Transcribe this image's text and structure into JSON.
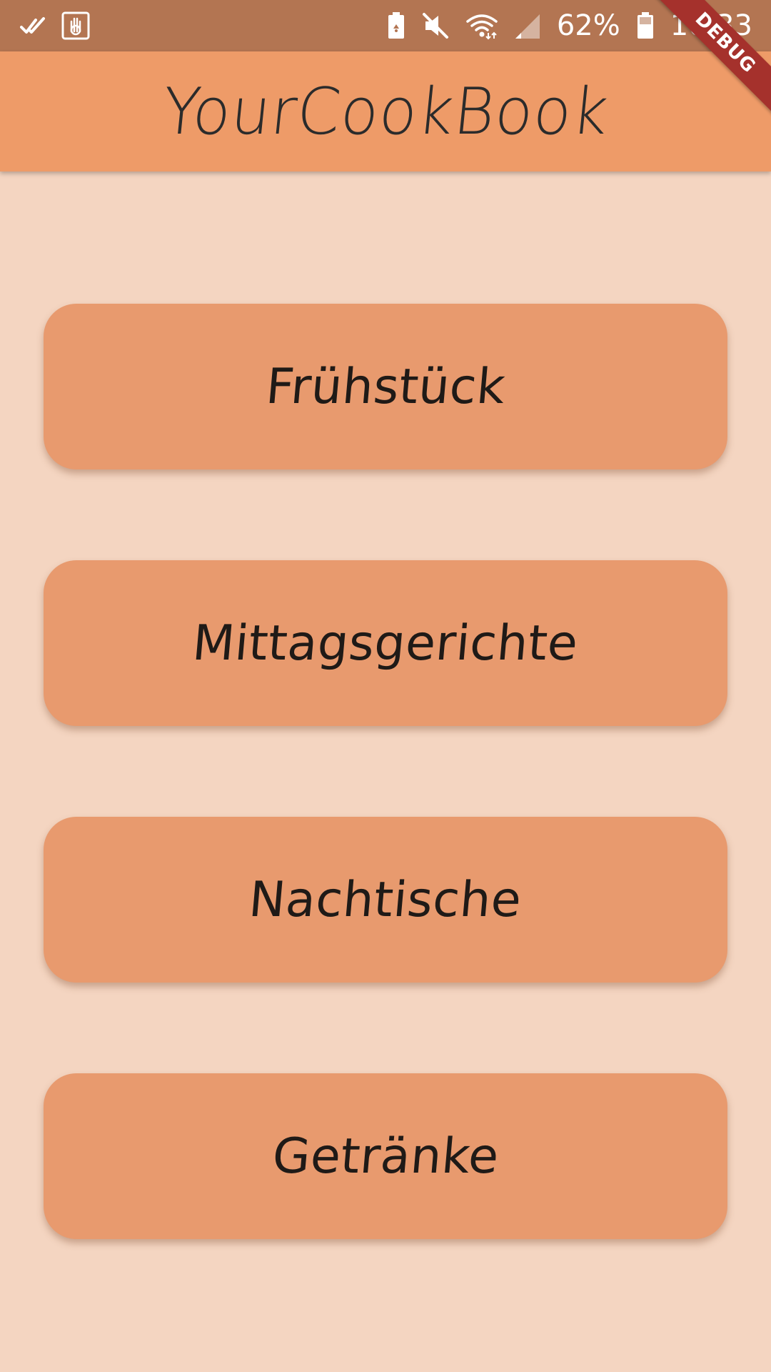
{
  "status_bar": {
    "battery_percent": "62%",
    "time": "10:33",
    "icons": [
      "double-check-icon",
      "hand-badge-icon",
      "battery-saver-icon",
      "mute-icon",
      "wifi-icon",
      "signal-icon",
      "battery-icon"
    ]
  },
  "app_bar": {
    "title": "YourCookBook"
  },
  "debug_banner": {
    "label": "DEBUG"
  },
  "categories": [
    {
      "label": "Frühstück"
    },
    {
      "label": "Mittagsgerichte"
    },
    {
      "label": "Nachtische"
    },
    {
      "label": "Getränke"
    }
  ],
  "colors": {
    "background": "#f4d5c1",
    "app_bar": "#ee9b68",
    "status_bar": "#b37552",
    "button": "#e89a6e",
    "debug_ribbon": "#a5312c"
  }
}
